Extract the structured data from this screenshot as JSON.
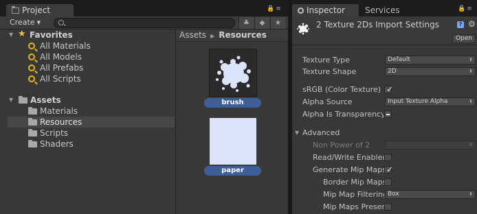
{
  "left_tabs": {
    "project": "Project"
  },
  "right_tabs": {
    "inspector": "Inspector",
    "services": "Services"
  },
  "project": {
    "create_label": "Create",
    "search_placeholder": "",
    "favorites": {
      "title": "Favorites",
      "items": [
        "All Materials",
        "All Models",
        "All Prefabs",
        "All Scripts"
      ]
    },
    "assets": {
      "title": "Assets",
      "folders": [
        "Materials",
        "Resources",
        "Scripts",
        "Shaders"
      ],
      "selected": "Resources"
    },
    "breadcrumb": {
      "root": "Assets",
      "current": "Resources"
    },
    "grid_items": [
      {
        "name": "brush"
      },
      {
        "name": "paper"
      }
    ]
  },
  "inspector": {
    "title": "2 Texture 2Ds Import Settings",
    "open_label": "Open",
    "texture_type": {
      "label": "Texture Type",
      "value": "Default"
    },
    "texture_shape": {
      "label": "Texture Shape",
      "value": "2D"
    },
    "srgb": {
      "label": "sRGB (Color Texture)",
      "checked": true
    },
    "alpha_source": {
      "label": "Alpha Source",
      "value": "Input Texture Alpha"
    },
    "alpha_transparency": {
      "label": "Alpha Is Transparency",
      "state": "mixed"
    },
    "advanced": {
      "label": "Advanced",
      "non_power_of_2": {
        "label": "Non Power of 2",
        "value": ""
      },
      "read_write": {
        "label": "Read/Write Enabled",
        "checked": false
      },
      "generate_mip": {
        "label": "Generate Mip Maps",
        "checked": true
      },
      "border_mip": {
        "label": "Border Mip Maps",
        "checked": false
      },
      "mip_filtering": {
        "label": "Mip Map Filtering",
        "value": "Box"
      },
      "mip_preserve": {
        "label": "Mip Maps Preserve Coverage",
        "checked": false
      }
    }
  },
  "colors": {
    "selection_label": "#3e5e9a",
    "favorite_star": "#f2c22a",
    "search_icon": "#e8b51e"
  }
}
